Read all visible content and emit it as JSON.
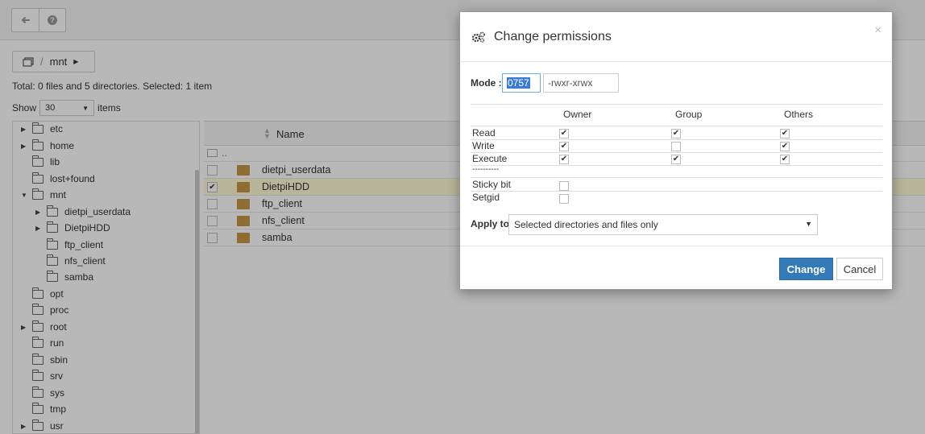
{
  "toolbar": {
    "back_icon": "arrow-left-icon",
    "help_icon": "question-circle-icon",
    "help_glyph": "?"
  },
  "breadcrumb": {
    "separator": "/",
    "current": "mnt"
  },
  "summary": {
    "totals": "Total: 0 files and 5 directories. Selected: 1 item",
    "show_label": "Show",
    "show_value": "30",
    "items_label": "items"
  },
  "tree": {
    "items": [
      {
        "label": "etc"
      },
      {
        "label": "home"
      },
      {
        "label": "lib"
      },
      {
        "label": "lost+found"
      },
      {
        "label": "mnt"
      },
      {
        "label": "dietpi_userdata"
      },
      {
        "label": "DietpiHDD"
      },
      {
        "label": "ftp_client"
      },
      {
        "label": "nfs_client"
      },
      {
        "label": "samba"
      },
      {
        "label": "opt"
      },
      {
        "label": "proc"
      },
      {
        "label": "root"
      },
      {
        "label": "run"
      },
      {
        "label": "sbin"
      },
      {
        "label": "srv"
      },
      {
        "label": "sys"
      },
      {
        "label": "tmp"
      },
      {
        "label": "usr"
      }
    ]
  },
  "files": {
    "name_header": "Name",
    "parent_label": "..",
    "rows": [
      {
        "name": "dietpi_userdata",
        "selected": false
      },
      {
        "name": "DietpiHDD",
        "selected": true
      },
      {
        "name": "ftp_client",
        "selected": false
      },
      {
        "name": "nfs_client",
        "selected": false
      },
      {
        "name": "samba",
        "selected": false
      }
    ]
  },
  "modal": {
    "title": "Change permissions",
    "close": "×",
    "mode_label": "Mode :",
    "mode_value": "0757",
    "mode_symbolic": "-rwxr-xrwx",
    "columns": [
      "Owner",
      "Group",
      "Others"
    ],
    "rows": [
      {
        "label": "Read",
        "owner": true,
        "group": true,
        "others": true
      },
      {
        "label": "Write",
        "owner": true,
        "group": false,
        "others": true
      },
      {
        "label": "Execute",
        "owner": true,
        "group": true,
        "others": true
      }
    ],
    "divider": "----------",
    "special": [
      {
        "label": "Sticky bit",
        "checked": false
      },
      {
        "label": "Setgid",
        "checked": false
      }
    ],
    "apply_label": "Apply to",
    "apply_value": "Selected directories and files only",
    "change_label": "Change",
    "cancel_label": "Cancel"
  },
  "colors": {
    "primary": "#337ab7",
    "folder": "#c8964a",
    "selected_row": "#fffbd6"
  }
}
